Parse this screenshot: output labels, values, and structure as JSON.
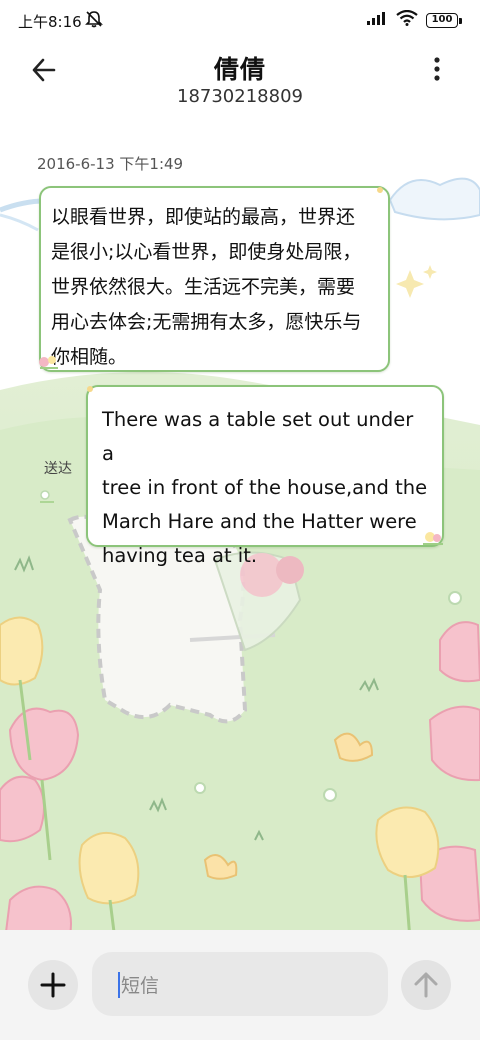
{
  "status_bar": {
    "time": "上午8:16",
    "battery": "100"
  },
  "header": {
    "contact_name": "倩倩",
    "contact_number": "18730218809"
  },
  "conversation": {
    "timestamp": "2016-6-13 下午1:49",
    "messages": [
      {
        "direction": "incoming",
        "lines": [
          "以眼看世界，即使站的最高，世界还",
          "是很小;以心看世界，即使身处局限，",
          "世界依然很大。生活远不完美，需要",
          "用心去体会;无需拥有太多，愿快乐与",
          "你相随。"
        ]
      },
      {
        "direction": "outgoing",
        "lines": [
          "There was a table set out under a",
          "tree in front of the house,and the",
          "March Hare and the Hatter were",
          "having tea at it."
        ],
        "status": "送达"
      }
    ]
  },
  "input_bar": {
    "placeholder": "短信"
  },
  "colors": {
    "bubble_border": "#8cc47a",
    "background_sky": "#ffffff",
    "background_grass": "#dcecc9",
    "caret": "#3b73e8"
  }
}
